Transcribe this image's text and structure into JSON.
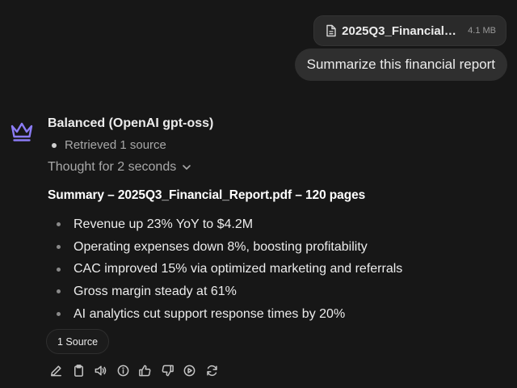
{
  "attachment": {
    "file_name": "2025Q3_Financial_Report.pdf",
    "file_size": "4.1 MB",
    "icon": "document-icon"
  },
  "user_message": "Summarize this financial report",
  "assistant": {
    "model_name": "Balanced (OpenAI gpt-oss)",
    "logo_icon": "crown-icon",
    "logo_color": "#8b7cf6",
    "retrieved": "Retrieved 1 source",
    "thought": "Thought for 2 seconds",
    "summary_title": "Summary – 2025Q3_Financial_Report.pdf – 120 pages",
    "bullets": [
      "Revenue up 23% YoY to $4.2M",
      "Operating expenses down 8%, boosting profitability",
      "CAC improved 15% via optimized marketing and referrals",
      "Gross margin steady at 61%",
      "AI analytics cut support response times by 20%"
    ],
    "source_button": "1 Source",
    "actions": [
      "edit-icon",
      "copy-icon",
      "speaker-icon",
      "info-icon",
      "thumbs-up-icon",
      "thumbs-down-icon",
      "play-icon",
      "refresh-icon"
    ]
  }
}
